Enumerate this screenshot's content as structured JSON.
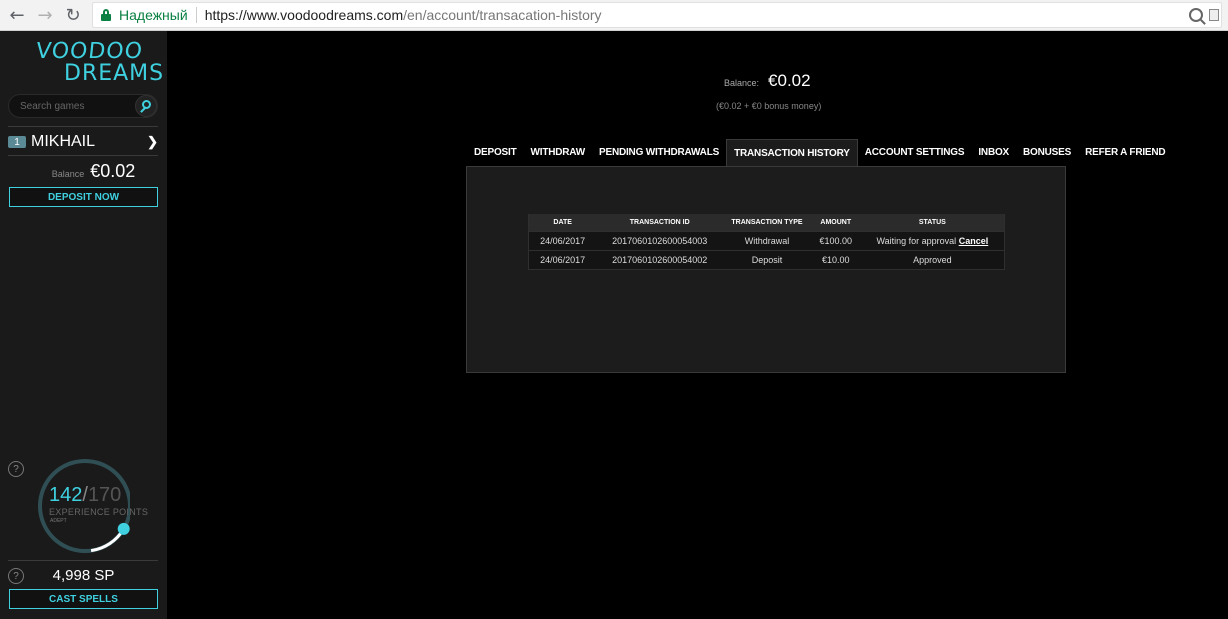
{
  "browser": {
    "secure_label": "Надежный",
    "url_host": "https://www.voodoodreams.com",
    "url_path": "/en/account/transacation-history"
  },
  "sidebar": {
    "logo_line1": "VOODOO",
    "logo_line2": "DREAMS",
    "search_placeholder": "Search games",
    "user_level": "1",
    "username": "MIKHAIL",
    "balance_label": "Balance",
    "balance_value": "€0.02",
    "deposit_button": "DEPOSIT NOW",
    "xp_current": "142",
    "xp_separator": "/",
    "xp_max": "170",
    "xp_label": "EXPERIENCE POINTS",
    "xp_rank": "ADEPT",
    "xp_progress": 0.835,
    "help_glyph": "?",
    "sp_value": "4,998 SP",
    "cast_button": "CAST SPELLS",
    "accent_color": "#3fd1e0"
  },
  "main": {
    "balance_label": "Balance:",
    "balance_value": "€0.02",
    "balance_breakdown": "(€0.02 + €0 bonus money)",
    "tabs": [
      {
        "label": "DEPOSIT",
        "active": false
      },
      {
        "label": "WITHDRAW",
        "active": false
      },
      {
        "label": "PENDING WITHDRAWALS",
        "active": false
      },
      {
        "label": "TRANSACTION HISTORY",
        "active": true
      },
      {
        "label": "ACCOUNT SETTINGS",
        "active": false
      },
      {
        "label": "INBOX",
        "active": false
      },
      {
        "label": "BONUSES",
        "active": false
      },
      {
        "label": "REFER A FRIEND",
        "active": false
      }
    ],
    "table": {
      "headers": [
        "DATE",
        "TRANSACTION ID",
        "TRANSACTION TYPE",
        "AMOUNT",
        "STATUS"
      ],
      "rows": [
        {
          "date": "24/06/2017",
          "id": "2017060102600054003",
          "type": "Withdrawal",
          "amount": "€100.00",
          "status": "Waiting for approval",
          "action": "Cancel"
        },
        {
          "date": "24/06/2017",
          "id": "2017060102600054002",
          "type": "Deposit",
          "amount": "€10.00",
          "status": "Approved",
          "action": ""
        }
      ]
    }
  }
}
